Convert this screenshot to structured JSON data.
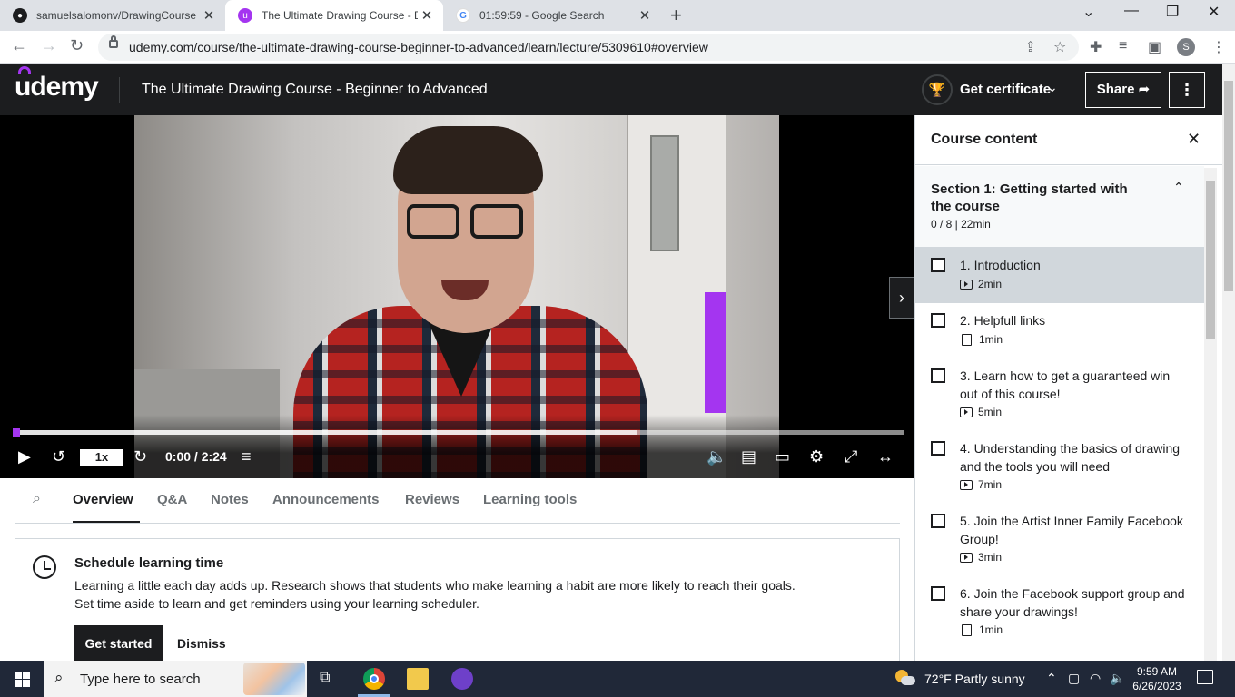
{
  "browser": {
    "tabs": [
      {
        "title": "samuelsalomonv/DrawingCourse",
        "active": false
      },
      {
        "title": "The Ultimate Drawing Course - B",
        "active": true
      },
      {
        "title": "01:59:59 - Google Search",
        "active": false
      }
    ],
    "url": "udemy.com/course/the-ultimate-drawing-course-beginner-to-advanced/learn/lecture/5309610#overview",
    "profile_initial": "S"
  },
  "header": {
    "logo": "udemy",
    "course_title": "The Ultimate Drawing Course - Beginner to Advanced",
    "get_certificate": "Get certificate",
    "share": "Share"
  },
  "player": {
    "speed": "1x",
    "time": "0:00 / 2:24",
    "progress": 0.0,
    "buffered": 0.7
  },
  "content_tabs": [
    "Overview",
    "Q&A",
    "Notes",
    "Announcements",
    "Reviews",
    "Learning tools"
  ],
  "reminder": {
    "title": "Schedule learning time",
    "line1": "Learning a little each day adds up. Research shows that students who make learning a habit are more likely to reach their goals.",
    "line2": "Set time aside to learn and get reminders using your learning scheduler.",
    "start": "Get started",
    "dismiss": "Dismiss"
  },
  "sidebar": {
    "title": "Course content",
    "section": {
      "title": "Section 1: Getting started with the course",
      "meta": "0 / 8 | 22min"
    },
    "lectures": [
      {
        "title": "1. Introduction",
        "duration": "2min",
        "kind": "video",
        "current": true
      },
      {
        "title": "2. Helpfull links",
        "duration": "1min",
        "kind": "doc",
        "current": false
      },
      {
        "title": "3. Learn how to get a guaranteed win out of this course!",
        "duration": "5min",
        "kind": "video",
        "current": false
      },
      {
        "title": "4. Understanding the basics of drawing and the tools you will need",
        "duration": "7min",
        "kind": "video",
        "current": false
      },
      {
        "title": "5. Join the Artist Inner Family Facebook Group!",
        "duration": "3min",
        "kind": "video",
        "current": false
      },
      {
        "title": "6. Join the Facebook support group and share your drawings!",
        "duration": "1min",
        "kind": "doc",
        "current": false
      }
    ]
  },
  "taskbar": {
    "search_placeholder": "Type here to search",
    "weather": "72°F  Partly sunny",
    "time": "9:59 AM",
    "date": "6/26/2023"
  },
  "colors": {
    "accent": "#a435f0",
    "dark": "#1c1d1f",
    "current_lecture_bg": "#d1d7dc"
  }
}
